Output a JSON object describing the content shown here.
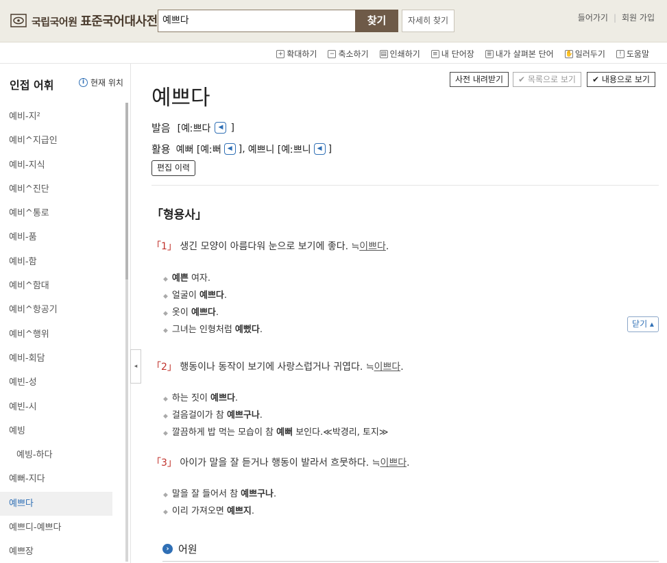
{
  "header": {
    "logo_prefix": "국립국어원",
    "logo_name": "표준국어대사전",
    "search_value": "예쁘다",
    "search_button": "찾기",
    "detail_button": "자세히 찾기",
    "login": "들어가기",
    "signup": "회원 가입"
  },
  "toolbar": {
    "items": [
      {
        "icon": "zoom-in-icon",
        "label": "확대하기"
      },
      {
        "icon": "zoom-out-icon",
        "label": "축소하기"
      },
      {
        "icon": "print-icon",
        "label": "인쇄하기"
      },
      {
        "icon": "wordbook-icon",
        "label": "내 단어장"
      },
      {
        "icon": "history-icon",
        "label": "내가 살펴본 단어"
      },
      {
        "icon": "report-icon",
        "label": "일러두기"
      },
      {
        "icon": "help-icon",
        "label": "도움말"
      }
    ]
  },
  "sidebar": {
    "title": "인접 어휘",
    "location": "현재 위치",
    "items": [
      {
        "label": "예비-지²"
      },
      {
        "label": "예비^지급인"
      },
      {
        "label": "예비-지식"
      },
      {
        "label": "예비^진단"
      },
      {
        "label": "예비^통로"
      },
      {
        "label": "예비-품"
      },
      {
        "label": "예비-함"
      },
      {
        "label": "예비^함대"
      },
      {
        "label": "예비^항공기"
      },
      {
        "label": "예비^행위"
      },
      {
        "label": "예비-회담"
      },
      {
        "label": "예빈-성"
      },
      {
        "label": "예빈-시"
      },
      {
        "label": "예빙"
      },
      {
        "label": "예빙-하다"
      },
      {
        "label": "예뻐-지다"
      },
      {
        "label": "예쁘다"
      },
      {
        "label": "예쁘디-예쁘다"
      },
      {
        "label": "예쁘장"
      }
    ]
  },
  "main": {
    "download_button": "사전 내려받기",
    "list_view_button": "✔ 목록으로 보기",
    "content_view_button": "✔ 내용으로 보기",
    "word": "예쁘다",
    "pron_label": "발음",
    "pron_value": "[예ː쁘다",
    "pron_close": "]",
    "conj_label": "활용",
    "conj_1": "예뻐 [예ː뻐",
    "conj_1_close": "],",
    "conj_2": "예쁘니 [예ː쁘니",
    "conj_2_close": "]",
    "edit_history": "편집 이력",
    "pos": "「형용사」",
    "close_button": "닫기 ▴",
    "etymology": "어원",
    "senses": [
      {
        "num": "「1」",
        "text": "생긴 모양이 아름다워 눈으로 보기에 좋다.",
        "arrow": "≒",
        "link": "이쁘다",
        "end": ".",
        "examples": [
          {
            "bold": "예쁜",
            "rest": " 여자."
          },
          {
            "pre": "얼굴이 ",
            "bold": "예쁘다",
            "rest": "."
          },
          {
            "pre": "옷이 ",
            "bold": "예쁘다",
            "rest": "."
          },
          {
            "pre": "그녀는 인형처럼 ",
            "bold": "예뻤다",
            "rest": "."
          }
        ]
      },
      {
        "num": "「2」",
        "text": "행동이나 동작이 보기에 사랑스럽거나 귀엽다.",
        "arrow": "≒",
        "link": "이쁘다",
        "end": ".",
        "examples": [
          {
            "pre": "하는 짓이 ",
            "bold": "예쁘다",
            "rest": "."
          },
          {
            "pre": "걸음걸이가 참 ",
            "bold": "예쁘구나",
            "rest": "."
          },
          {
            "pre": "깔끔하게 밥 먹는 모습이 참 ",
            "bold": "예뻐",
            "rest": " 보인다.≪박경리, 토지≫"
          }
        ]
      },
      {
        "num": "「3」",
        "text": "아이가 말을 잘 듣거나 행동이 발라서 흐뭇하다.",
        "arrow": "≒",
        "link": "이쁘다",
        "end": ".",
        "examples": [
          {
            "pre": "말을 잘 들어서 참 ",
            "bold": "예쁘구나",
            "rest": "."
          },
          {
            "pre": "이리 가져오면 ",
            "bold": "예쁘지",
            "rest": "."
          }
        ]
      }
    ]
  }
}
